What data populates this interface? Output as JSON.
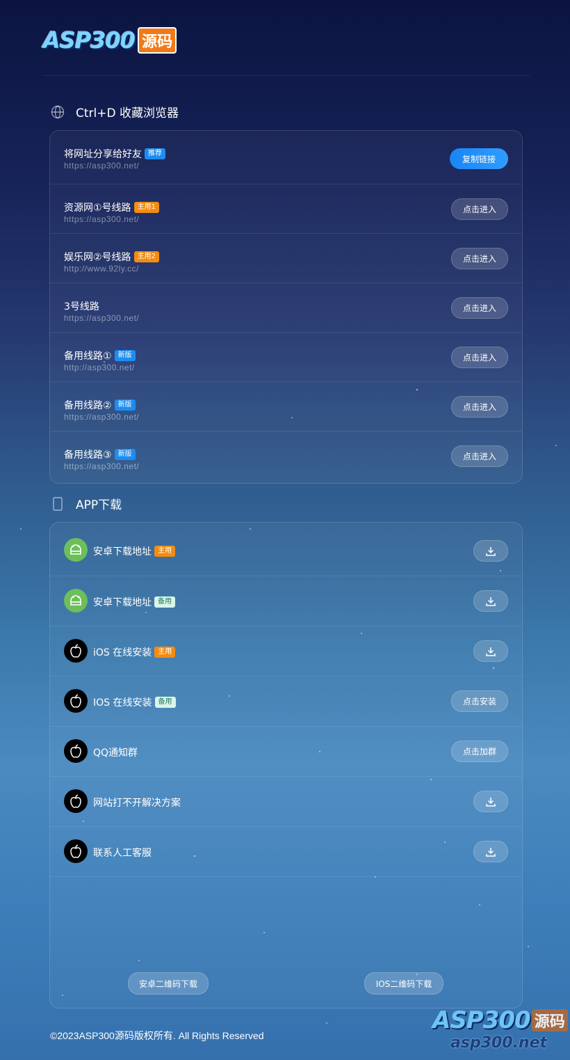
{
  "logo": {
    "main": "ASP300",
    "badge": "源码"
  },
  "sections": {
    "bookmark_title": "Ctrl+D 收藏浏览器",
    "app_title": "APP下载"
  },
  "links": [
    {
      "name": "将网址分享给好友",
      "badge": "推荐",
      "badge_style": "blue",
      "url": "https://asp300.net/",
      "button": "复制链接"
    },
    {
      "name": "资源网①号线路",
      "badge": "主用1",
      "badge_style": "orange",
      "url": "https://asp300.net/",
      "button": "点击进入"
    },
    {
      "name": "娱乐网②号线路",
      "badge": "主用2",
      "badge_style": "orange",
      "url": "http://www.92ly.cc/",
      "button": "点击进入"
    },
    {
      "name": "3号线路",
      "badge": "",
      "badge_style": "",
      "url": "https://asp300.net/",
      "button": "点击进入"
    },
    {
      "name": "备用线路①",
      "badge": "新版",
      "badge_style": "blue",
      "url": "http://asp300.net/",
      "button": "点击进入"
    },
    {
      "name": "备用线路②",
      "badge": "新版",
      "badge_style": "blue",
      "url": "https://asp300.net/",
      "button": "点击进入"
    },
    {
      "name": "备用线路③",
      "badge": "新版",
      "badge_style": "blue",
      "url": "https://asp300.net/",
      "button": "点击进入"
    }
  ],
  "apps": [
    {
      "icon": "android-icon",
      "name": "安卓下载地址",
      "badge": "主用",
      "badge_style": "orange",
      "button": "",
      "button_icon": "download-icon"
    },
    {
      "icon": "android-icon",
      "name": "安卓下载地址",
      "badge": "备用",
      "badge_style": "mint",
      "button": "",
      "button_icon": "download-icon"
    },
    {
      "icon": "apple-icon",
      "name": "iOS 在线安装",
      "badge": "主用",
      "badge_style": "orange",
      "button": "",
      "button_icon": "download-icon"
    },
    {
      "icon": "apple-icon",
      "name": "IOS 在线安装",
      "badge": "备用",
      "badge_style": "mint",
      "button": "点击安装",
      "button_icon": ""
    },
    {
      "icon": "apple-icon",
      "name": "QQ通知群",
      "badge": "",
      "badge_style": "",
      "button": "点击加群",
      "button_icon": ""
    },
    {
      "icon": "apple-icon",
      "name": "网站打不开解决方案",
      "badge": "",
      "badge_style": "",
      "button": "",
      "button_icon": "download-icon"
    },
    {
      "icon": "apple-icon",
      "name": "联系人工客服",
      "badge": "",
      "badge_style": "",
      "button": "",
      "button_icon": "download-icon"
    }
  ],
  "qr_buttons": {
    "android": "安卓二维码下载",
    "ios": "IOS二维码下载"
  },
  "footer": "©2023ASP300源码版权所有. All Rights Reserved",
  "watermark": {
    "main": "ASP300",
    "badge": "源码",
    "url": "asp300.net"
  },
  "colors": {
    "accent": "#1e8cf0",
    "orange_badge": "#f28c12",
    "android": "#6cbf5a"
  }
}
